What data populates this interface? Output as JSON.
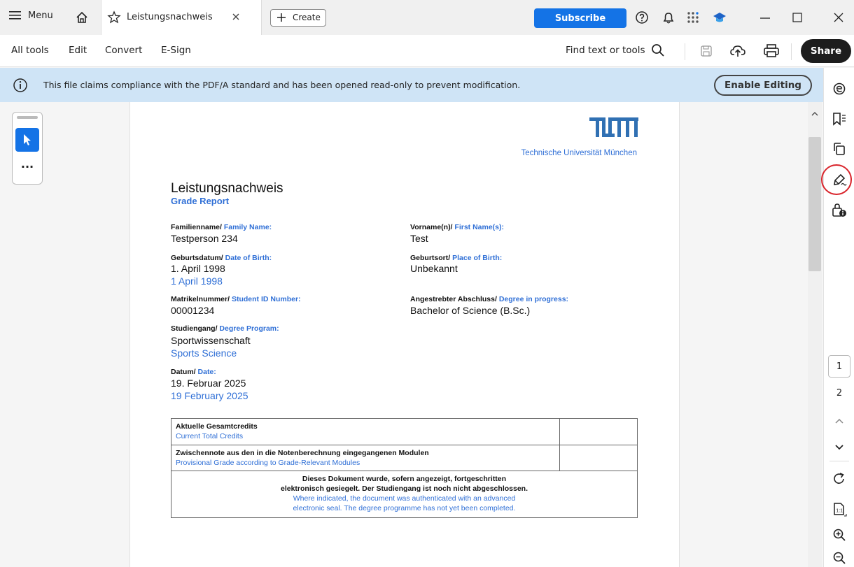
{
  "titlebar": {
    "menu_label": "Menu",
    "tab_title": "Leistungsnachweis",
    "create_label": "Create",
    "subscribe_label": "Subscribe"
  },
  "toolbar": {
    "items": [
      "All tools",
      "Edit",
      "Convert",
      "E-Sign"
    ],
    "find_label": "Find text or tools",
    "share_label": "Share"
  },
  "banner": {
    "message": "This file claims compliance with the PDF/A standard and has been opened read-only to prevent modification.",
    "enable_label": "Enable Editing"
  },
  "left_tools": {
    "more_label": "..."
  },
  "page_nav": {
    "current_page": "1",
    "next_page": "2"
  },
  "document": {
    "logo_text": "TUM",
    "university": "Technische Universität München",
    "title": "Leistungsnachweis",
    "subtitle": "Grade Report",
    "family_name": {
      "label_de": "Familienname/",
      "label_en": "Family Name:",
      "value": "Testperson 234"
    },
    "first_name": {
      "label_de": "Vorname(n)/",
      "label_en": "First Name(s):",
      "value": "Test"
    },
    "birth_date": {
      "label_de": "Geburtsdatum/",
      "label_en": "Date of Birth:",
      "value_de": "1. April 1998",
      "value_en": "1 April 1998"
    },
    "birth_place": {
      "label_de": "Geburtsort/",
      "label_en": "Place of Birth:",
      "value": "Unbekannt"
    },
    "student_id": {
      "label_de": "Matrikelnummer/",
      "label_en": "Student ID Number:",
      "value": "00001234"
    },
    "degree": {
      "label_de": "Angestrebter Abschluss/",
      "label_en": "Degree in progress:",
      "value": "Bachelor of Science (B.Sc.)"
    },
    "program": {
      "label_de": "Studiengang/",
      "label_en": "Degree Program:",
      "value_de": "Sportwissenschaft",
      "value_en": "Sports Science"
    },
    "date": {
      "label_de": "Datum/",
      "label_en": "Date:",
      "value_de": "19. Februar 2025",
      "value_en": "19 February 2025"
    },
    "table": {
      "row1_de": "Aktuelle Gesamtcredits",
      "row1_en": "Current Total Credits",
      "row2_de": "Zwischennote aus den in die Notenberechnung eingegangenen Modulen",
      "row2_en": "Provisional Grade according to Grade-Relevant Modules",
      "note_de1": "Dieses Dokument wurde, sofern angezeigt, fortgeschritten",
      "note_de2": "elektronisch gesiegelt. Der Studiengang ist noch nicht abgeschlossen.",
      "note_en1": "Where indicated, the document was authenticated with an advanced",
      "note_en2": "electronic seal. The degree programme has not yet been completed."
    }
  },
  "colors": {
    "accent": "#1473e6",
    "banner_bg": "#cfe4f6",
    "doc_blue": "#2f6fd6",
    "tum_blue": "#3070b3",
    "highlight_circle": "#d9242b"
  }
}
